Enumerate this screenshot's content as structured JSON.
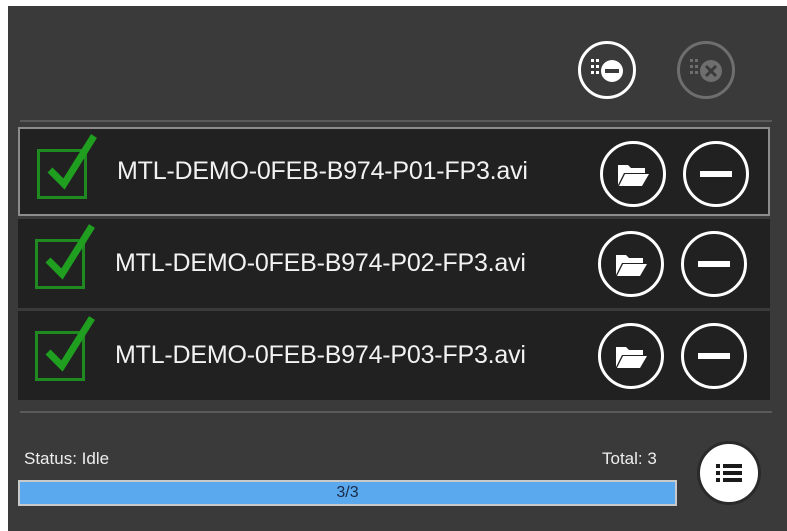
{
  "toolbar": {
    "remove_selected_icon": "list-remove-icon",
    "clear_all_icon": "list-clear-icon"
  },
  "files": [
    {
      "name": "MTL-DEMO-0FEB-B974-P01-FP3.avi",
      "checked": true
    },
    {
      "name": "MTL-DEMO-0FEB-B974-P02-FP3.avi",
      "checked": true
    },
    {
      "name": "MTL-DEMO-0FEB-B974-P03-FP3.avi",
      "checked": true
    }
  ],
  "footer": {
    "status": "Status: Idle",
    "total": "Total: 3",
    "progress_label": "3/3",
    "progress_fraction": 1.0
  },
  "colors": {
    "panel_bg": "#3a3a3a",
    "row_bg": "#212121",
    "check_green": "#1f8a1f",
    "progress_blue": "#3f9be8"
  }
}
